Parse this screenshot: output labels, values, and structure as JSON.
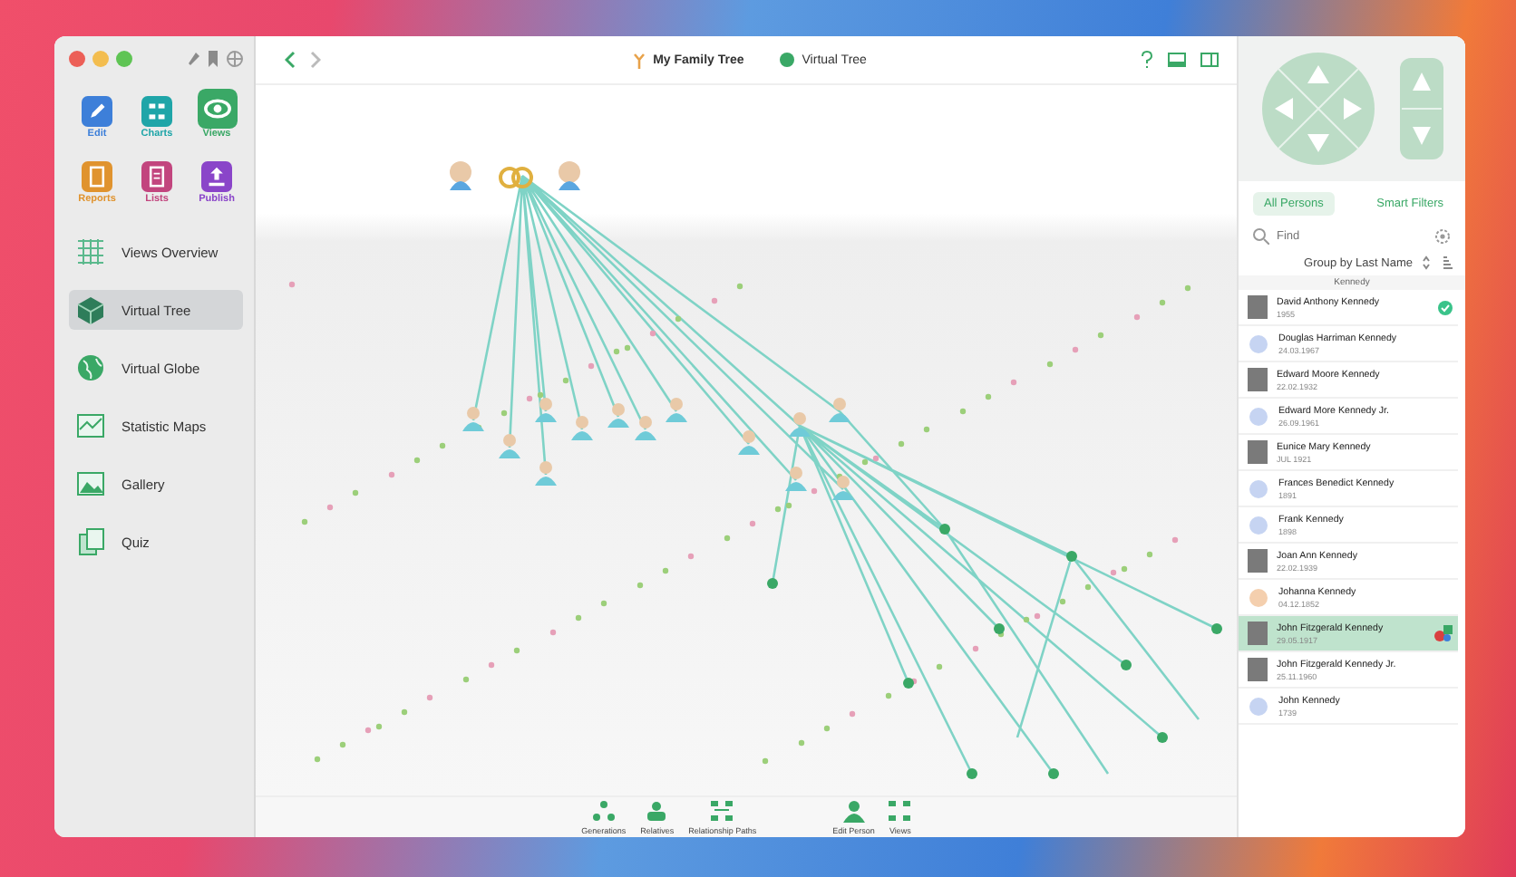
{
  "window": {
    "title": "My Family Tree",
    "view": "Virtual Tree"
  },
  "sidebar": {
    "tools": [
      {
        "label": "Edit",
        "color": "#3d7fd9",
        "selected": false
      },
      {
        "label": "Charts",
        "color": "#1fa5a8",
        "selected": false
      },
      {
        "label": "Views",
        "color": "#3aa866",
        "selected": true
      },
      {
        "label": "Reports",
        "color": "#e0932e",
        "selected": false
      },
      {
        "label": "Lists",
        "color": "#c2457e",
        "selected": false
      },
      {
        "label": "Publish",
        "color": "#8a45c9",
        "selected": false
      }
    ],
    "items": [
      {
        "label": "Views Overview",
        "selected": false
      },
      {
        "label": "Virtual Tree",
        "selected": true
      },
      {
        "label": "Virtual Globe",
        "selected": false
      },
      {
        "label": "Statistic Maps",
        "selected": false
      },
      {
        "label": "Gallery",
        "selected": false
      },
      {
        "label": "Quiz",
        "selected": false
      }
    ]
  },
  "toolbar": [
    "Generations",
    "Relatives",
    "Relationship Paths",
    "Edit Person",
    "Views"
  ],
  "panel": {
    "tabs": [
      {
        "label": "All Persons",
        "selected": true
      },
      {
        "label": "Smart Filters",
        "selected": false
      }
    ],
    "search": {
      "placeholder": "Find"
    },
    "group_by": "Group by Last Name",
    "section": "Kennedy",
    "persons": [
      {
        "name": "David Anthony Kennedy",
        "date": "1955",
        "kind": "photo",
        "selected": false,
        "verified": true,
        "tagged": false
      },
      {
        "name": "Douglas Harriman Kennedy",
        "date": "24.03.1967",
        "kind": "dot",
        "color": "#c6d4f2",
        "selected": false,
        "verified": false,
        "tagged": false
      },
      {
        "name": "Edward Moore Kennedy",
        "date": "22.02.1932",
        "kind": "photo",
        "selected": false,
        "verified": false,
        "tagged": false
      },
      {
        "name": "Edward More Kennedy Jr.",
        "date": "26.09.1961",
        "kind": "dot",
        "color": "#c6d4f2",
        "selected": false,
        "verified": false,
        "tagged": false
      },
      {
        "name": "Eunice Mary Kennedy",
        "date": "JUL 1921",
        "kind": "photo",
        "selected": false,
        "verified": false,
        "tagged": false
      },
      {
        "name": "Frances Benedict Kennedy",
        "date": "1891",
        "kind": "dot",
        "color": "#c6d4f2",
        "selected": false,
        "verified": false,
        "tagged": false
      },
      {
        "name": "Frank Kennedy",
        "date": "1898",
        "kind": "dot",
        "color": "#c6d4f2",
        "selected": false,
        "verified": false,
        "tagged": false
      },
      {
        "name": "Joan Ann Kennedy",
        "date": "22.02.1939",
        "kind": "photo",
        "selected": false,
        "verified": false,
        "tagged": false
      },
      {
        "name": "Johanna Kennedy",
        "date": "04.12.1852",
        "kind": "dot",
        "color": "#f4cfae",
        "selected": false,
        "verified": false,
        "tagged": false
      },
      {
        "name": "John Fitzgerald Kennedy",
        "date": "29.05.1917",
        "kind": "photo",
        "selected": true,
        "verified": false,
        "tagged": true
      },
      {
        "name": "John Fitzgerald Kennedy Jr.",
        "date": "25.11.1960",
        "kind": "photo",
        "selected": false,
        "verified": false,
        "tagged": false
      },
      {
        "name": "John Kennedy",
        "date": "1739",
        "kind": "dot",
        "color": "#c6d4f2",
        "selected": false,
        "verified": false,
        "tagged": false
      }
    ]
  }
}
